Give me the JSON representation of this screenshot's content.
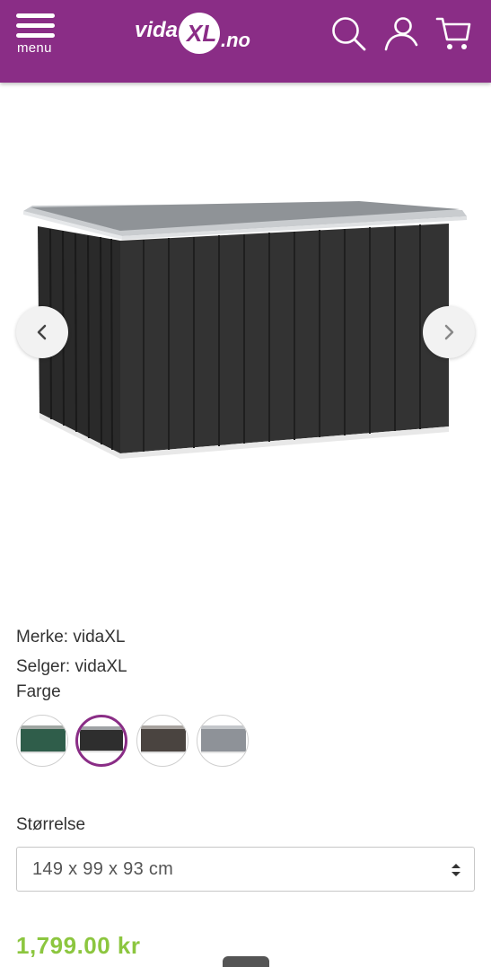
{
  "header": {
    "menu_label": "menu",
    "logo_text": "vidaXL.no",
    "background_color": "#8a2d86",
    "icons": [
      "search-icon",
      "user-icon",
      "cart-icon"
    ]
  },
  "gallery": {
    "prev_icon": "chevron-left-icon",
    "next_icon": "chevron-right-icon"
  },
  "product": {
    "brand_line": "Merke: vidaXL",
    "seller_line": "Selger: vidaXL",
    "color_label": "Farge",
    "color_options": [
      {
        "color": "#2f5d4a",
        "selected": false
      },
      {
        "color": "#2e2e2e",
        "selected": true
      },
      {
        "color": "#4a4440",
        "selected": false
      },
      {
        "color": "#8e9298",
        "selected": false
      }
    ],
    "size_label": "Størrelse",
    "size_value": "149 x 99 x 93 cm",
    "price": "1,799.00 kr",
    "accent_color": "#8a2d86",
    "price_color": "#8cc63f"
  }
}
